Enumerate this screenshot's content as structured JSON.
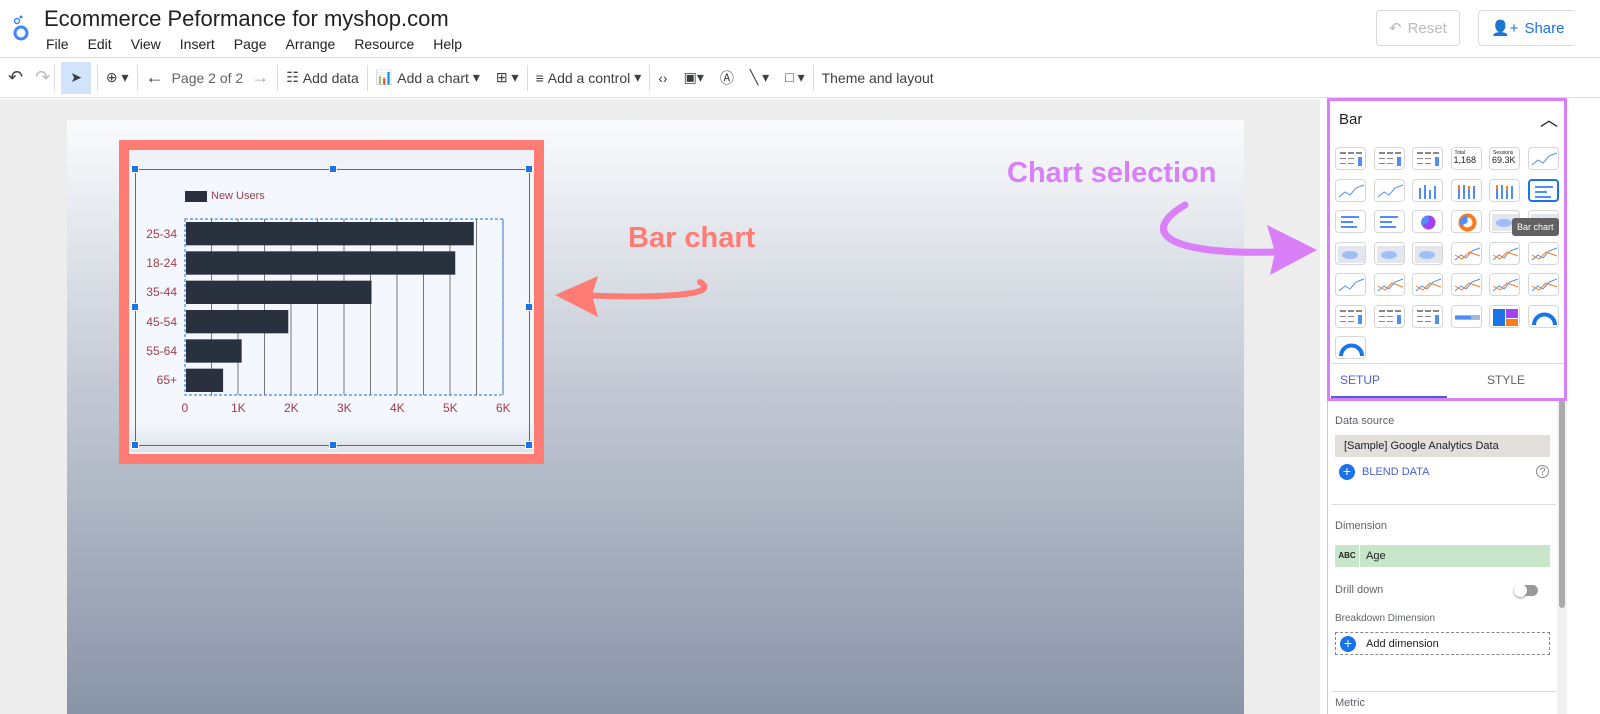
{
  "app": {
    "title": "Ecommerce Peformance for myshop.com",
    "menu": [
      "File",
      "Edit",
      "View",
      "Insert",
      "Page",
      "Arrange",
      "Resource",
      "Help"
    ],
    "reset": "Reset",
    "share": "Share"
  },
  "toolbar": {
    "page": "Page 2 of 2",
    "add_data": "Add data",
    "add_chart": "Add a chart",
    "add_control": "Add a control",
    "theme": "Theme and layout"
  },
  "chart_data": {
    "type": "bar",
    "orientation": "horizontal",
    "categories": [
      "25-34",
      "18-24",
      "35-44",
      "45-54",
      "55-64",
      "65+"
    ],
    "series": [
      {
        "name": "New Users",
        "values": [
          5430,
          5080,
          3500,
          1930,
          1050,
          700
        ]
      }
    ],
    "xticks": [
      "0",
      "1K",
      "2K",
      "3K",
      "4K",
      "5K",
      "6K"
    ],
    "xlim": [
      0,
      6000
    ],
    "grid": true,
    "legend": "top-left",
    "color": "#28313d"
  },
  "panel": {
    "header": "Bar",
    "tooltip": "Bar chart",
    "tabs": [
      "SETUP",
      "STYLE"
    ],
    "data_source_label": "Data source",
    "data_source": "[Sample] Google Analytics Data",
    "blend": "BLEND DATA",
    "dimension_label": "Dimension",
    "dimension_type": "ABC",
    "dimension": "Age",
    "drill_down": "Drill down",
    "breakdown_label": "Breakdown Dimension",
    "add_dimension": "Add dimension",
    "metric_label": "Metric",
    "tile_texts": {
      "total_label": "Total",
      "total": "1,168",
      "sessions_label": "Sessions",
      "sessions": "69.3K"
    }
  },
  "annotations": {
    "bar_chart": "Bar chart",
    "chart_selection": "Chart selection",
    "colors": {
      "bar": "#ff7c74",
      "selection": "#d97ff7"
    }
  }
}
